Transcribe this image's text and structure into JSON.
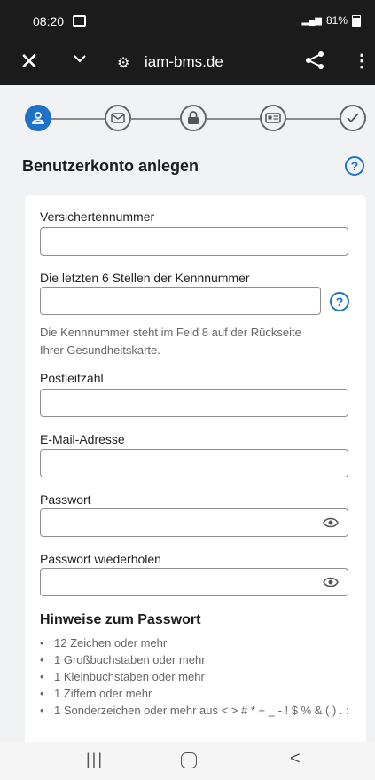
{
  "status_bar": {
    "time": "08:20",
    "signal": "📶",
    "battery": "81%"
  },
  "toolbar": {
    "url": "iam-bms.de",
    "close_glyph": "✕",
    "more_glyph": "⋮",
    "tune_glyph": "⚙"
  },
  "form": {
    "title": "Benutzerkonto anlegen",
    "help_glyph": "?",
    "versichertennummer_label": "Versichertennummer",
    "kennnummer_label": "Die letzten 6 Stellen der Kennnummer",
    "kennnummer_hint": "Die Kennnummer steht im Feld 8 auf der Rückseite Ihrer Gesundheitskarte.",
    "plz_label": "Postleitzahl",
    "email_label": "E-Mail-Adresse",
    "password_label": "Passwort",
    "password_repeat_label": "Passwort wiederholen"
  },
  "password_hints": {
    "title": "Hinweise zum Passwort",
    "items": [
      "12 Zeichen oder mehr",
      "1 Großbuchstaben oder mehr",
      "1 Kleinbuchstaben oder mehr",
      "1 Ziffern oder mehr",
      "1 Sonderzeichen oder mehr aus < > # * + _ - ! $ % & ( ) . :"
    ]
  },
  "nav": {
    "recents_glyph": "|||",
    "back_glyph": "<"
  },
  "colors": {
    "accent": "#1f73c6",
    "toolbar_bg": "#1b1b1b",
    "page_bg": "#f1f2f4"
  },
  "icons": [
    "close-icon",
    "chevron-down-icon",
    "tune-icon",
    "share-icon",
    "more-icon",
    "user-icon",
    "mail-icon",
    "lock-icon",
    "id-card-icon",
    "check-icon",
    "help-icon",
    "eye-icon"
  ]
}
